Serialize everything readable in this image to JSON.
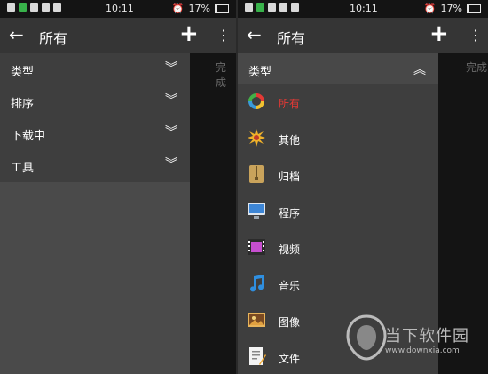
{
  "status_bar": {
    "time": "10:11",
    "battery": "17%",
    "battery_level": 0.17
  },
  "left_screen": {
    "title": "所有",
    "done_label": "完成",
    "menu_items": [
      {
        "label": "类型"
      },
      {
        "label": "排序"
      },
      {
        "label": "下载中"
      },
      {
        "label": "工具"
      }
    ]
  },
  "right_screen": {
    "title": "所有",
    "done_label": "完成",
    "category_header": "类型",
    "type_items": [
      {
        "label": "所有",
        "icon": "all-arrows-icon",
        "selected": true
      },
      {
        "label": "其他",
        "icon": "burst-icon",
        "selected": false
      },
      {
        "label": "归档",
        "icon": "archive-icon",
        "selected": false
      },
      {
        "label": "程序",
        "icon": "monitor-icon",
        "selected": false
      },
      {
        "label": "视频",
        "icon": "film-icon",
        "selected": false
      },
      {
        "label": "音乐",
        "icon": "music-note-icon",
        "selected": false
      },
      {
        "label": "图像",
        "icon": "image-icon",
        "selected": false
      },
      {
        "label": "文件",
        "icon": "document-icon",
        "selected": false
      }
    ]
  },
  "watermark": {
    "text": "当下软件园",
    "url": "www.downxia.com"
  },
  "colors": {
    "selected_label": "#e53935",
    "appbar": "#353535",
    "drawer": "#3e3e3e"
  }
}
